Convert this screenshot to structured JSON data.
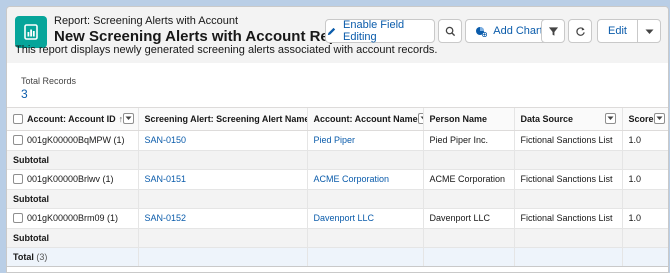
{
  "header": {
    "eyebrow": "Report: Screening Alerts with Account",
    "title": "New Screening Alerts with Account Report",
    "description": "This report displays newly generated screening alerts associated with account records."
  },
  "toolbar": {
    "enable_field_editing": "Enable Field Editing",
    "add_chart": "Add Chart",
    "edit": "Edit"
  },
  "summary": {
    "total_records_label": "Total Records",
    "total_records_value": "3"
  },
  "table": {
    "columns": [
      "Account: Account ID",
      "Screening Alert: Screening Alert Name",
      "Account: Account Name",
      "Person Name",
      "Data Source",
      "Score"
    ],
    "rows": [
      {
        "account_id": "001gK00000BqMPW (1)",
        "alert_name": "SAN-0150",
        "account_name": "Pied Piper",
        "person_name": "Pied Piper Inc.",
        "data_source": "Fictional Sanctions List",
        "score": "1.0"
      },
      {
        "account_id": "001gK00000Brlwv (1)",
        "alert_name": "SAN-0151",
        "account_name": "ACME Corporation",
        "person_name": "ACME Corporation",
        "data_source": "Fictional Sanctions List",
        "score": "1.0"
      },
      {
        "account_id": "001gK00000Brm09 (1)",
        "alert_name": "SAN-0152",
        "account_name": "Davenport LLC",
        "person_name": "Davenport LLC",
        "data_source": "Fictional Sanctions List",
        "score": "1.0"
      }
    ],
    "subtotal_label": "Subtotal",
    "total_label": "Total",
    "total_count": "(3)"
  },
  "colors": {
    "accent": "#0b5cab",
    "icon_bg": "#06a59a"
  },
  "icons": [
    "report-icon",
    "pencil-icon",
    "search-icon",
    "add-chart-icon",
    "filter-icon",
    "refresh-icon",
    "chevron-down-icon",
    "sort-arrow-icon"
  ]
}
